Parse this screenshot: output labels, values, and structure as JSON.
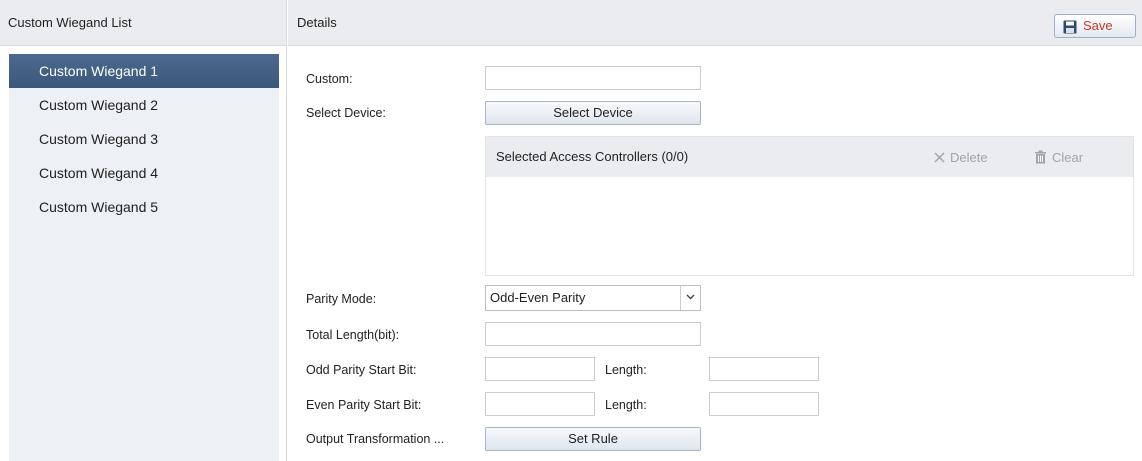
{
  "left": {
    "title": "Custom Wiegand List",
    "items": [
      {
        "label": "Custom Wiegand 1",
        "selected": true
      },
      {
        "label": "Custom Wiegand 2",
        "selected": false
      },
      {
        "label": "Custom Wiegand 3",
        "selected": false
      },
      {
        "label": "Custom Wiegand 4",
        "selected": false
      },
      {
        "label": "Custom Wiegand 5",
        "selected": false
      }
    ]
  },
  "details": {
    "title": "Details",
    "save_label": "Save",
    "save_icon": "floppy-disk-icon",
    "custom_label": "Custom:",
    "custom_value": "",
    "select_device_label": "Select Device:",
    "select_device_button": "Select Device",
    "access_controllers": {
      "title": "Selected Access Controllers (0/0)",
      "delete_label": "Delete",
      "delete_icon": "close-icon",
      "clear_label": "Clear",
      "clear_icon": "trash-icon"
    },
    "parity_mode_label": "Parity Mode:",
    "parity_mode_value": "Odd-Even Parity",
    "total_length_label": "Total Length(bit):",
    "total_length_value": "",
    "odd_parity_label": "Odd Parity Start Bit:",
    "odd_parity_value": "",
    "odd_length_label": "Length:",
    "odd_length_value": "",
    "even_parity_label": "Even Parity Start Bit:",
    "even_parity_value": "",
    "even_length_label": "Length:",
    "even_length_value": "",
    "output_transformation_label": "Output Transformation ...",
    "set_rule_button": "Set Rule"
  },
  "colors": {
    "selected_item": "#39587c",
    "save_text": "#c0392b",
    "header_bg": "#eaecef"
  }
}
